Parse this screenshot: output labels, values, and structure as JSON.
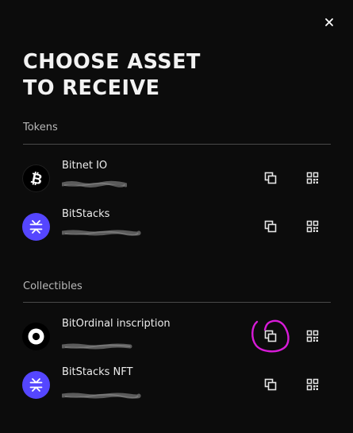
{
  "header": {
    "title_line1": "CHOOSE ASSET",
    "title_line2": "TO RECEIVE",
    "close_icon": "close-icon"
  },
  "sections": {
    "tokens_label": "Tokens",
    "collectibles_label": "Collectibles"
  },
  "assets": [
    {
      "name": "Bitnet IO",
      "icon": "bitcoin-icon",
      "address_redacted": true
    },
    {
      "name": "BitStacks",
      "icon": "stacks-icon",
      "address_redacted": true
    },
    {
      "name": "BitOrdinal inscription",
      "icon": "ordinal-icon",
      "address_redacted": true
    },
    {
      "name": "BitStacks NFT",
      "icon": "stacks-icon",
      "address_redacted": true
    }
  ],
  "actions": {
    "copy_icon": "copy-icon",
    "qr_icon": "qr-code-icon"
  },
  "colors": {
    "background": "#0c0c0c",
    "stacks_purple": "#5546ff",
    "annotation": "#d81bd8",
    "divider": "#4a4a4a"
  }
}
